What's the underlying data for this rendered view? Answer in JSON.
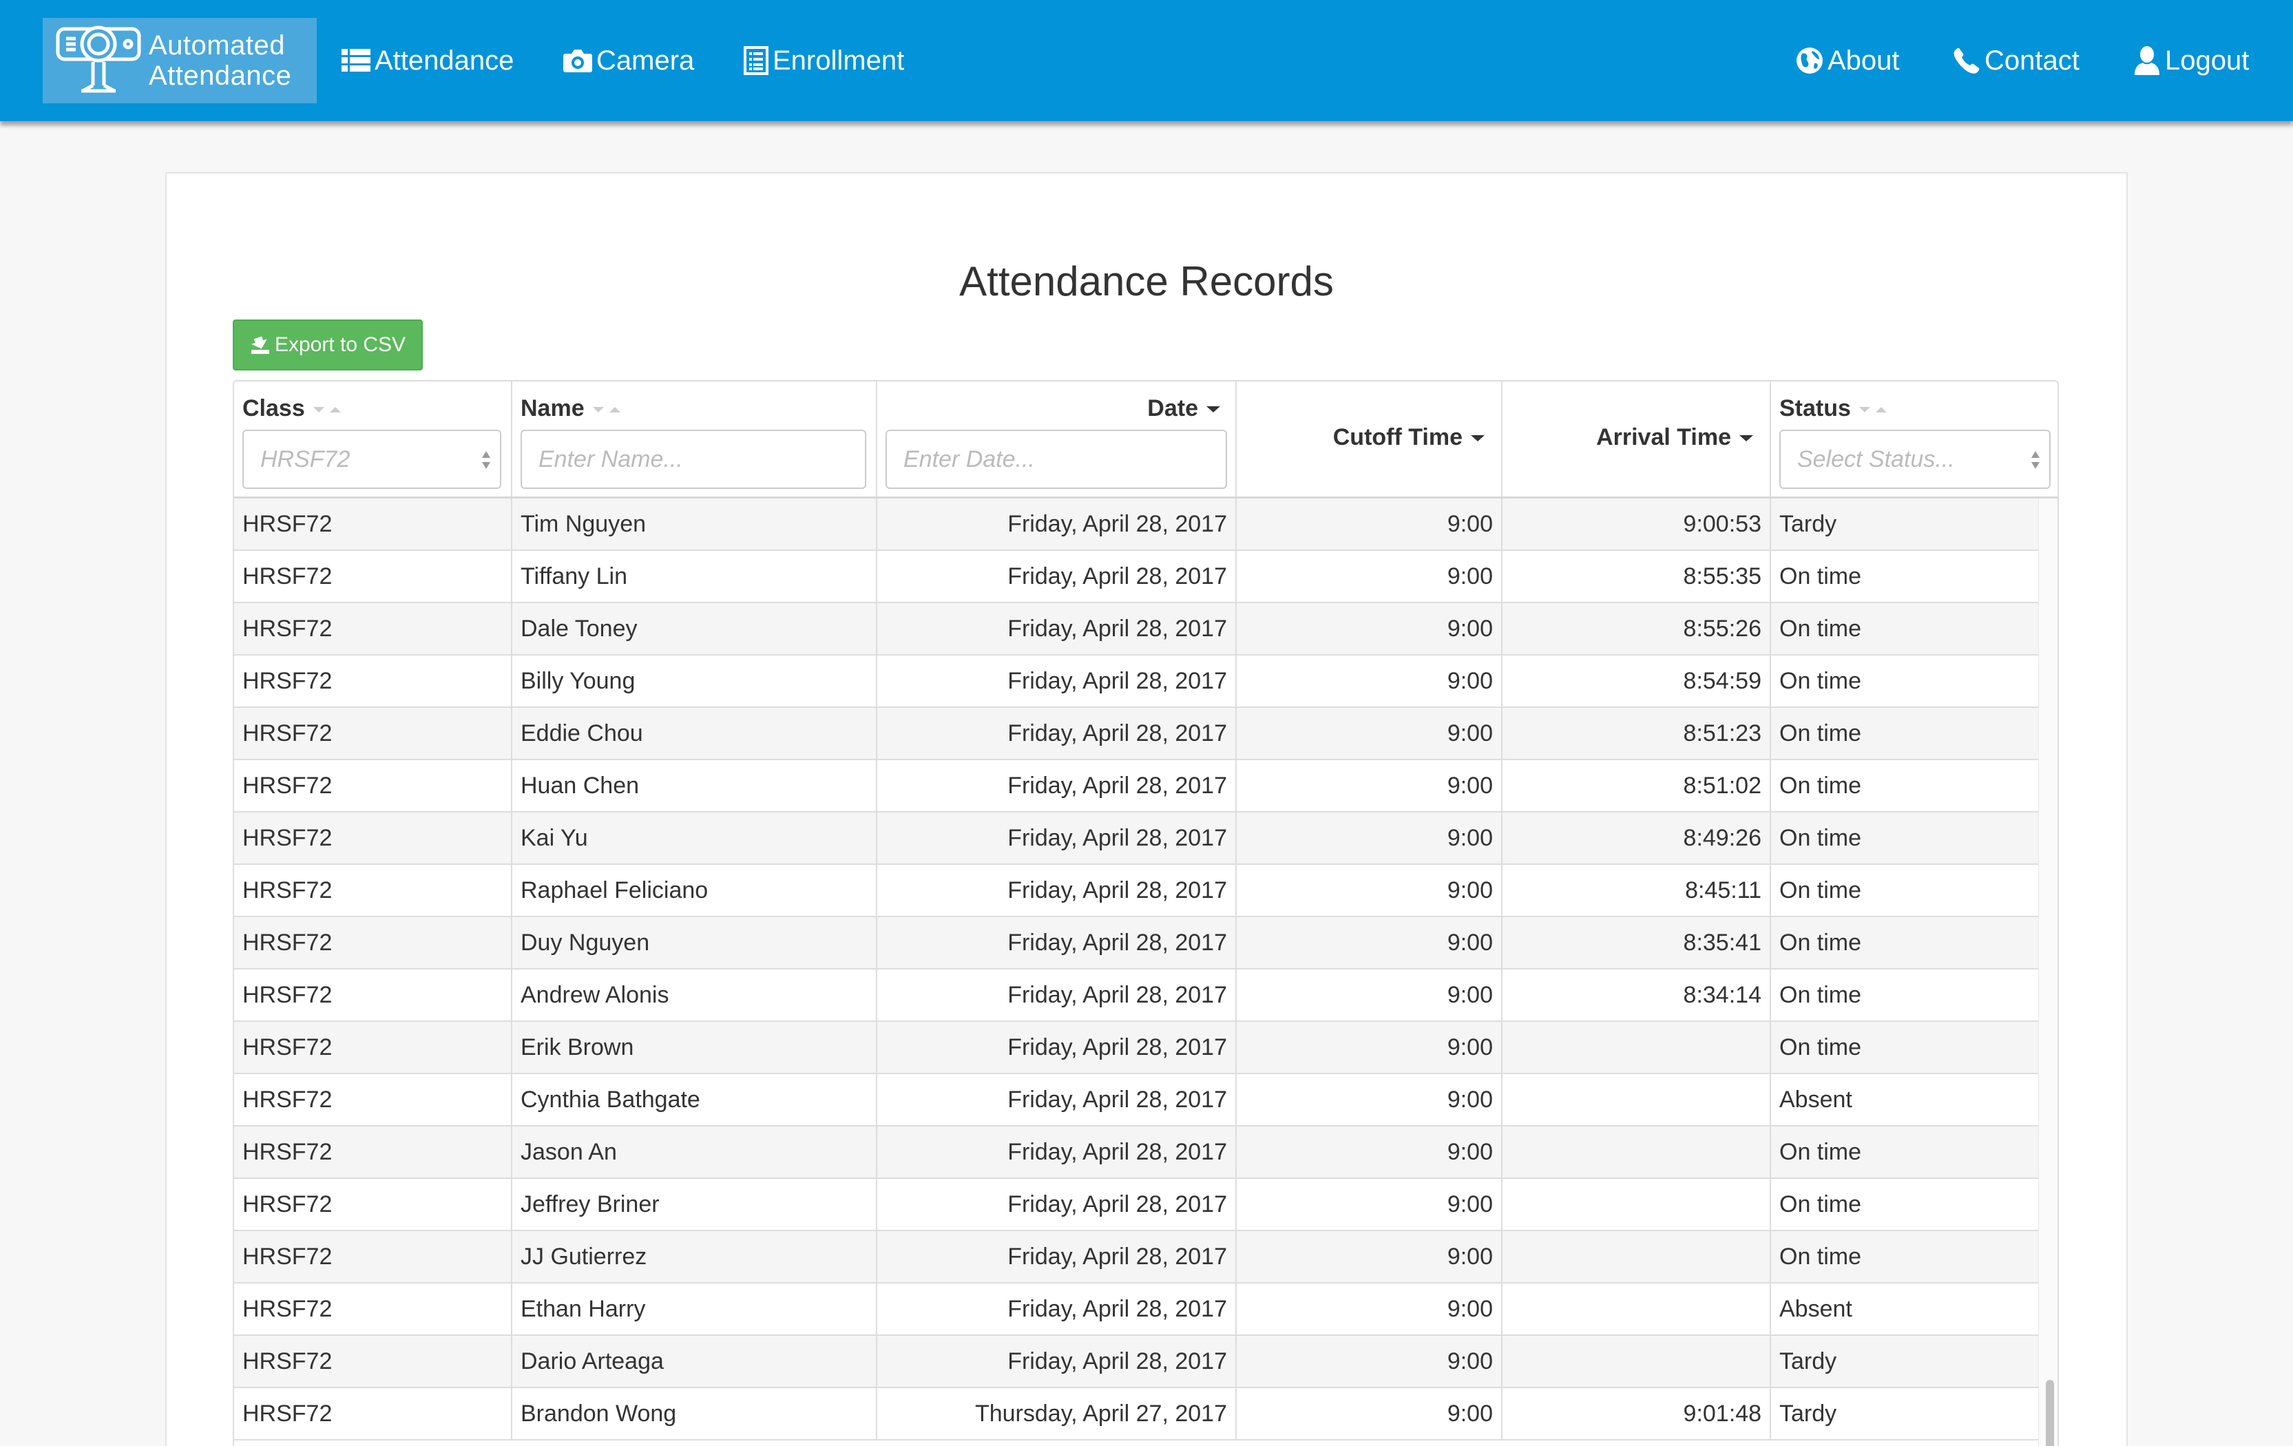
{
  "app": {
    "brand_line1": "Automated",
    "brand_line2": "Attendance"
  },
  "nav": {
    "left": [
      {
        "label": "Attendance",
        "icon": "list-icon"
      },
      {
        "label": "Camera",
        "icon": "camera-icon"
      },
      {
        "label": "Enrollment",
        "icon": "document-list-icon"
      }
    ],
    "right": [
      {
        "label": "About",
        "icon": "globe-icon"
      },
      {
        "label": "Contact",
        "icon": "phone-icon"
      },
      {
        "label": "Logout",
        "icon": "user-icon"
      }
    ]
  },
  "page": {
    "title": "Attendance Records",
    "export_label": "Export to CSV"
  },
  "table": {
    "columns": [
      {
        "label": "Class",
        "sort": "unsorted"
      },
      {
        "label": "Name",
        "sort": "unsorted"
      },
      {
        "label": "Date",
        "sort": "descending"
      },
      {
        "label": "Cutoff Time",
        "sort": "descending"
      },
      {
        "label": "Arrival Time",
        "sort": "descending"
      },
      {
        "label": "Status",
        "sort": "unsorted"
      }
    ],
    "filters": {
      "class_placeholder": "HRSF72",
      "name_placeholder": "Enter Name...",
      "date_placeholder": "Enter Date...",
      "status_placeholder": "Select Status..."
    },
    "rows": [
      {
        "class": "HRSF72",
        "name": "Tim Nguyen",
        "date": "Friday, April 28, 2017",
        "cutoff": "9:00",
        "arrival": "9:00:53",
        "status": "Tardy"
      },
      {
        "class": "HRSF72",
        "name": "Tiffany Lin",
        "date": "Friday, April 28, 2017",
        "cutoff": "9:00",
        "arrival": "8:55:35",
        "status": "On time"
      },
      {
        "class": "HRSF72",
        "name": "Dale Toney",
        "date": "Friday, April 28, 2017",
        "cutoff": "9:00",
        "arrival": "8:55:26",
        "status": "On time"
      },
      {
        "class": "HRSF72",
        "name": "Billy Young",
        "date": "Friday, April 28, 2017",
        "cutoff": "9:00",
        "arrival": "8:54:59",
        "status": "On time"
      },
      {
        "class": "HRSF72",
        "name": "Eddie Chou",
        "date": "Friday, April 28, 2017",
        "cutoff": "9:00",
        "arrival": "8:51:23",
        "status": "On time"
      },
      {
        "class": "HRSF72",
        "name": "Huan Chen",
        "date": "Friday, April 28, 2017",
        "cutoff": "9:00",
        "arrival": "8:51:02",
        "status": "On time"
      },
      {
        "class": "HRSF72",
        "name": "Kai Yu",
        "date": "Friday, April 28, 2017",
        "cutoff": "9:00",
        "arrival": "8:49:26",
        "status": "On time"
      },
      {
        "class": "HRSF72",
        "name": "Raphael Feliciano",
        "date": "Friday, April 28, 2017",
        "cutoff": "9:00",
        "arrival": "8:45:11",
        "status": "On time"
      },
      {
        "class": "HRSF72",
        "name": "Duy Nguyen",
        "date": "Friday, April 28, 2017",
        "cutoff": "9:00",
        "arrival": "8:35:41",
        "status": "On time"
      },
      {
        "class": "HRSF72",
        "name": "Andrew Alonis",
        "date": "Friday, April 28, 2017",
        "cutoff": "9:00",
        "arrival": "8:34:14",
        "status": "On time"
      },
      {
        "class": "HRSF72",
        "name": "Erik Brown",
        "date": "Friday, April 28, 2017",
        "cutoff": "9:00",
        "arrival": "",
        "status": "On time"
      },
      {
        "class": "HRSF72",
        "name": "Cynthia Bathgate",
        "date": "Friday, April 28, 2017",
        "cutoff": "9:00",
        "arrival": "",
        "status": "Absent"
      },
      {
        "class": "HRSF72",
        "name": "Jason An",
        "date": "Friday, April 28, 2017",
        "cutoff": "9:00",
        "arrival": "",
        "status": "On time"
      },
      {
        "class": "HRSF72",
        "name": "Jeffrey Briner",
        "date": "Friday, April 28, 2017",
        "cutoff": "9:00",
        "arrival": "",
        "status": "On time"
      },
      {
        "class": "HRSF72",
        "name": "JJ Gutierrez",
        "date": "Friday, April 28, 2017",
        "cutoff": "9:00",
        "arrival": "",
        "status": "On time"
      },
      {
        "class": "HRSF72",
        "name": "Ethan Harry",
        "date": "Friday, April 28, 2017",
        "cutoff": "9:00",
        "arrival": "",
        "status": "Absent"
      },
      {
        "class": "HRSF72",
        "name": "Dario Arteaga",
        "date": "Friday, April 28, 2017",
        "cutoff": "9:00",
        "arrival": "",
        "status": "Tardy"
      },
      {
        "class": "HRSF72",
        "name": "Brandon Wong",
        "date": "Thursday, April 27, 2017",
        "cutoff": "9:00",
        "arrival": "9:01:48",
        "status": "Tardy"
      }
    ]
  },
  "colors": {
    "navbar": "#0293d9",
    "brand_box": "#4aa8dc",
    "export_button": "#5cb85c",
    "row_stripe": "#f5f5f5"
  }
}
